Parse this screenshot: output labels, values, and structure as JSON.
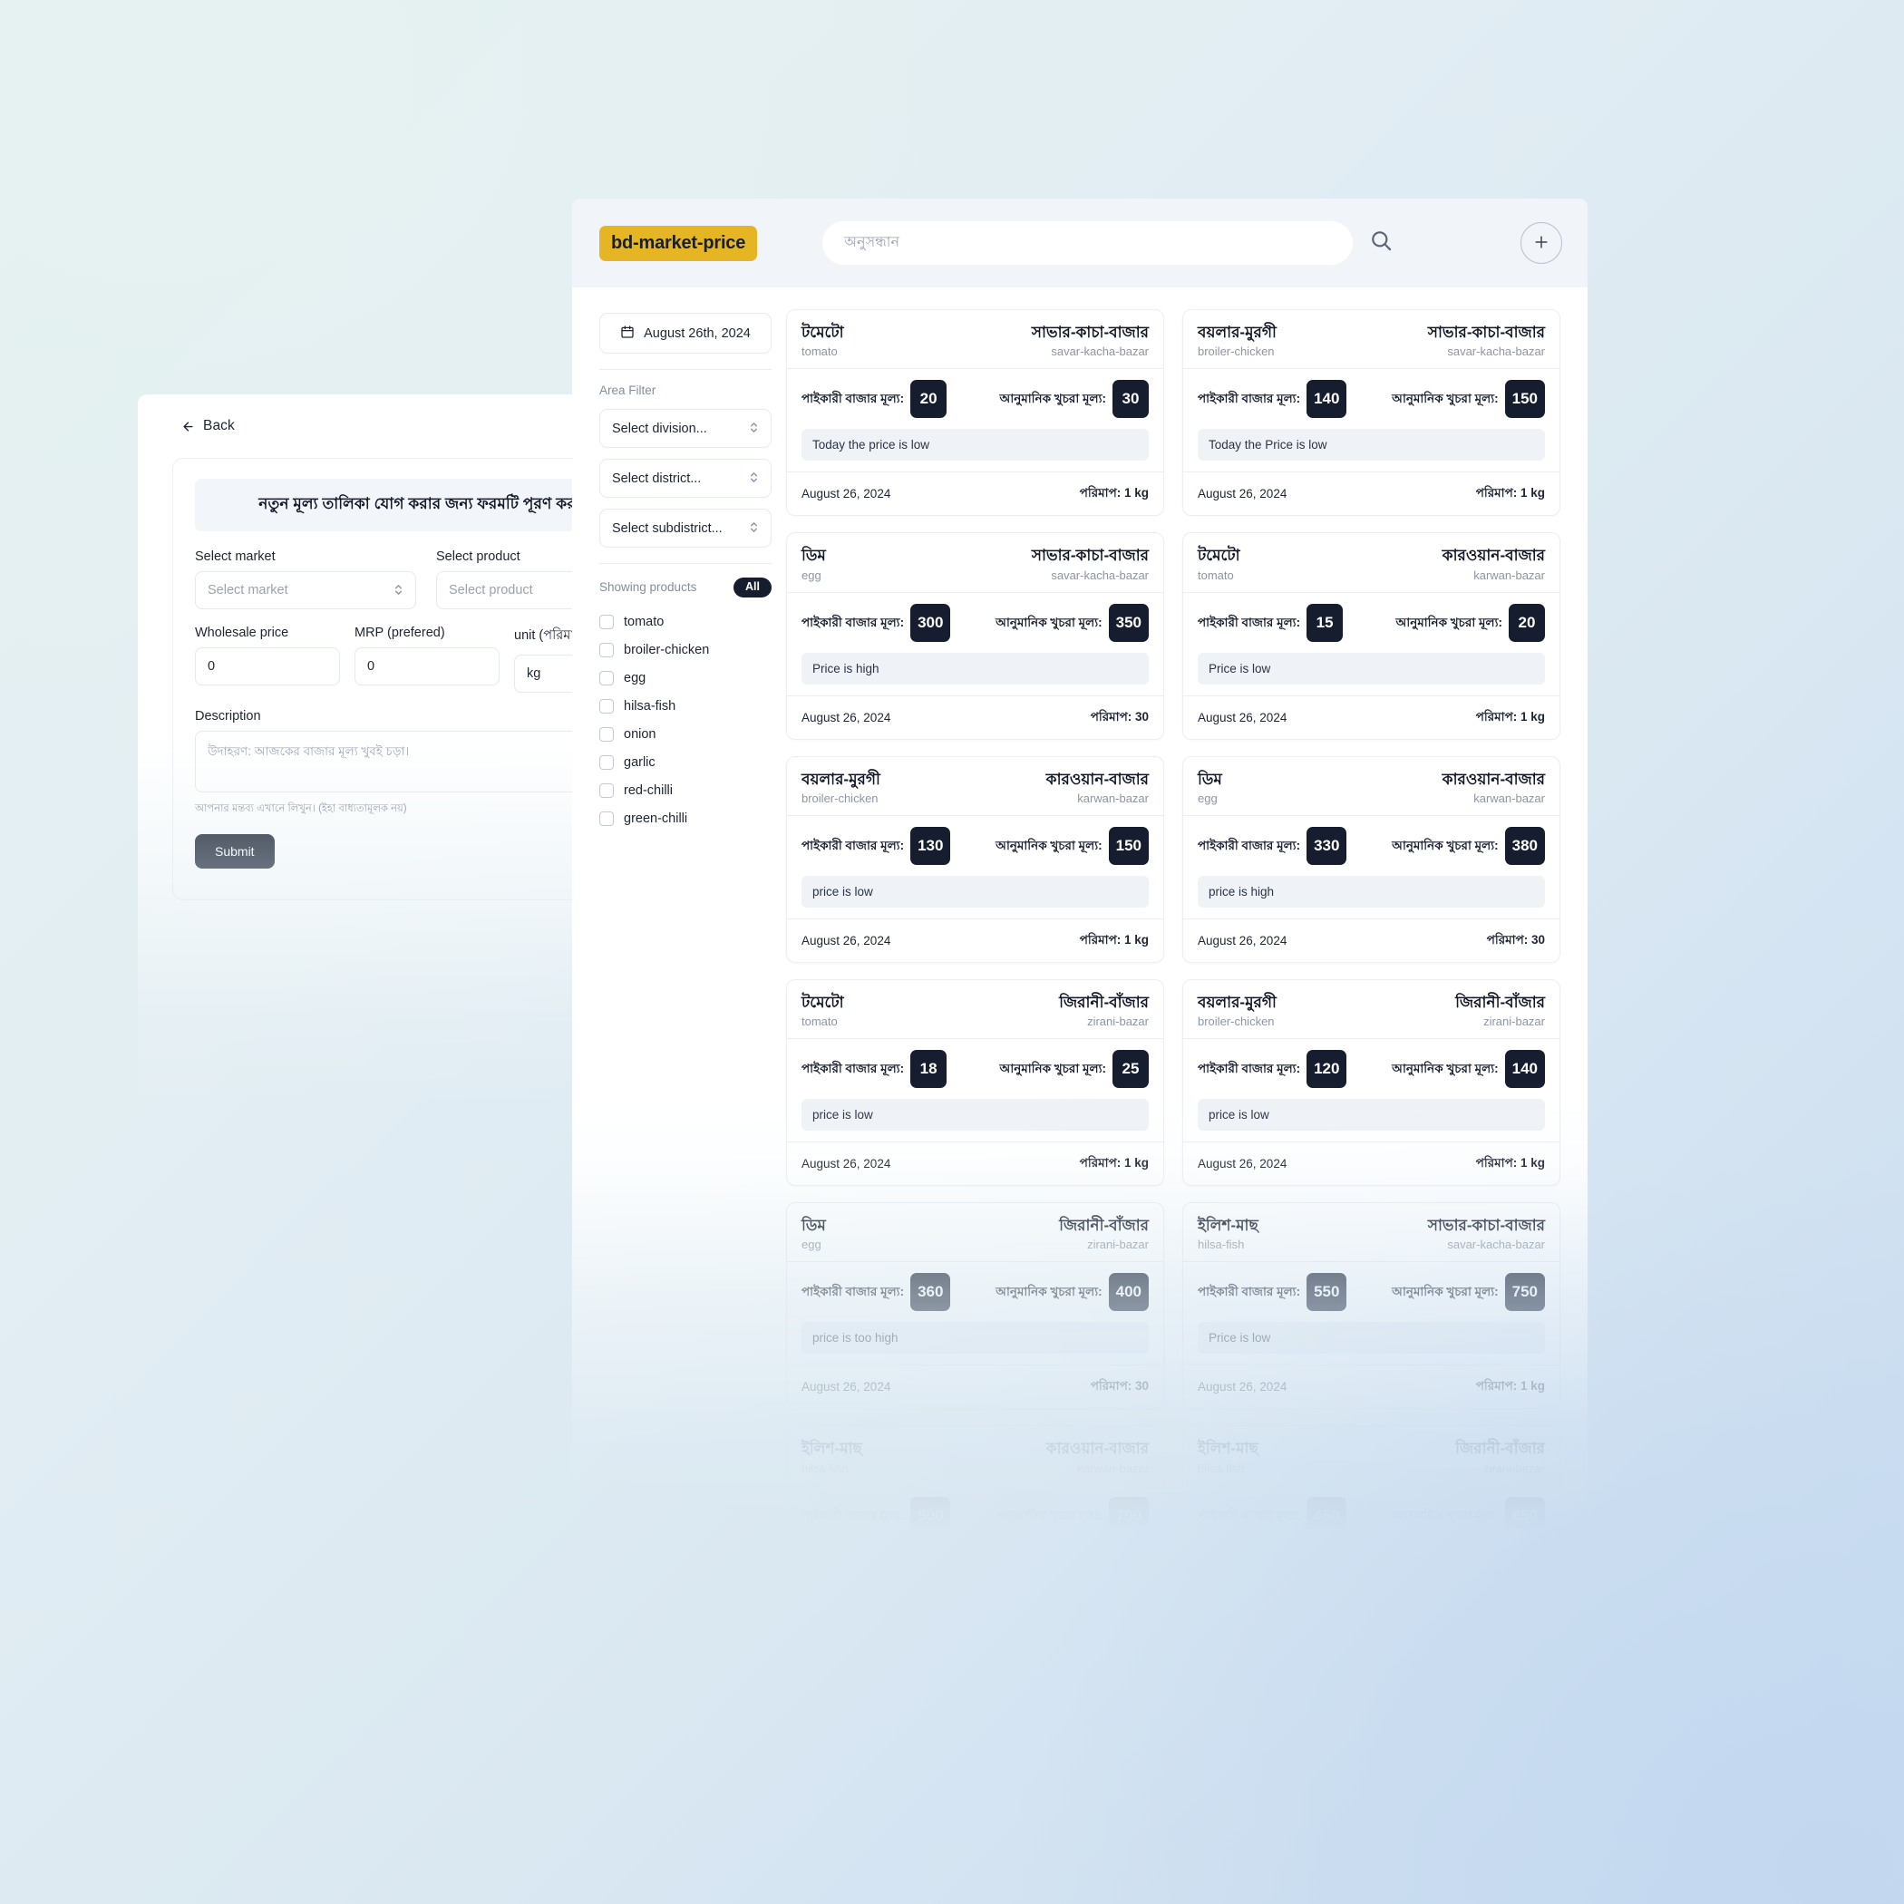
{
  "background_form": {
    "back_label": "Back",
    "title": "নতুন মূল্য তালিকা যোগ করার জন্য ফরমটি পূরণ করুন।",
    "fields": {
      "market_label": "Select market",
      "market_placeholder": "Select market",
      "product_label": "Select product",
      "product_placeholder": "Select product",
      "wholesale_label": "Wholesale price",
      "wholesale_value": "0",
      "mrp_label": "MRP (prefered)",
      "mrp_value": "0",
      "unit_label": "unit (পরিমাপ)",
      "unit_value": "kg",
      "description_label": "Description",
      "description_placeholder": "উদাহরণ: আজকের বাজার মূল্য খুবই চড়া।",
      "description_helper": "আপনার মন্তব্য এখানে লিখুন। (ইহা বাধ্যতামূলক নয়)"
    },
    "submit_label": "Submit"
  },
  "header": {
    "logo": "bd-market-price",
    "search_placeholder": "অনুসন্ধান",
    "search_value": "",
    "search_icon": "search-icon",
    "add_icon": "plus-icon"
  },
  "sidebar": {
    "date_icon": "calendar-icon",
    "date_label": "August 26th, 2024",
    "area_filter_label": "Area Filter",
    "selects": [
      {
        "label": "Select division...",
        "icon": "chevron-updown-icon"
      },
      {
        "label": "Select district...",
        "icon": "chevron-updown-icon"
      },
      {
        "label": "Select subdistrict...",
        "icon": "chevron-updown-icon"
      }
    ],
    "showing_label": "Showing products",
    "showing_badge": "All",
    "products": [
      {
        "label": "tomato",
        "checked": false
      },
      {
        "label": "broiler-chicken",
        "checked": false
      },
      {
        "label": "egg",
        "checked": false
      },
      {
        "label": "hilsa-fish",
        "checked": false
      },
      {
        "label": "onion",
        "checked": false
      },
      {
        "label": "garlic",
        "checked": false
      },
      {
        "label": "red-chilli",
        "checked": false
      },
      {
        "label": "green-chilli",
        "checked": false
      }
    ]
  },
  "card_labels": {
    "wholesale": "পাইকারী বাজার মূল্য:",
    "retail": "আনুমানিক খুচরা মূল্য:"
  },
  "colors": {
    "logo_bg": "#e5b523",
    "badge_bg": "#161d2e",
    "note_bg": "#eff2f7",
    "header_bg": "#f1f4f8"
  },
  "cards": [
    {
      "product_bn": "টমেটো",
      "product_en": "tomato",
      "market_bn": "সাভার-কাচা-বাজার",
      "market_en": "savar-kacha-bazar",
      "wholesale": "20",
      "retail": "30",
      "note": "Today the price is low",
      "date": "August 26, 2024",
      "measure": "পরিমাপ: 1 kg"
    },
    {
      "product_bn": "বয়লার-মুরগী",
      "product_en": "broiler-chicken",
      "market_bn": "সাভার-কাচা-বাজার",
      "market_en": "savar-kacha-bazar",
      "wholesale": "140",
      "retail": "150",
      "note": "Today the Price is low",
      "date": "August 26, 2024",
      "measure": "পরিমাপ: 1 kg"
    },
    {
      "product_bn": "ডিম",
      "product_en": "egg",
      "market_bn": "সাভার-কাচা-বাজার",
      "market_en": "savar-kacha-bazar",
      "wholesale": "300",
      "retail": "350",
      "note": "Price is high",
      "date": "August 26, 2024",
      "measure": "পরিমাপ: 30"
    },
    {
      "product_bn": "টমেটো",
      "product_en": "tomato",
      "market_bn": "কারওয়ান-বাজার",
      "market_en": "karwan-bazar",
      "wholesale": "15",
      "retail": "20",
      "note": "Price is low",
      "date": "August 26, 2024",
      "measure": "পরিমাপ: 1 kg"
    },
    {
      "product_bn": "বয়লার-মুরগী",
      "product_en": "broiler-chicken",
      "market_bn": "কারওয়ান-বাজার",
      "market_en": "karwan-bazar",
      "wholesale": "130",
      "retail": "150",
      "note": "price is low",
      "date": "August 26, 2024",
      "measure": "পরিমাপ: 1 kg"
    },
    {
      "product_bn": "ডিম",
      "product_en": "egg",
      "market_bn": "কারওয়ান-বাজার",
      "market_en": "karwan-bazar",
      "wholesale": "330",
      "retail": "380",
      "note": "price is high",
      "date": "August 26, 2024",
      "measure": "পরিমাপ: 30"
    },
    {
      "product_bn": "টমেটো",
      "product_en": "tomato",
      "market_bn": "জিরানী-বাঁজার",
      "market_en": "zirani-bazar",
      "wholesale": "18",
      "retail": "25",
      "note": "price is low",
      "date": "August 26, 2024",
      "measure": "পরিমাপ: 1 kg"
    },
    {
      "product_bn": "বয়লার-মুরগী",
      "product_en": "broiler-chicken",
      "market_bn": "জিরানী-বাঁজার",
      "market_en": "zirani-bazar",
      "wholesale": "120",
      "retail": "140",
      "note": "price is low",
      "date": "August 26, 2024",
      "measure": "পরিমাপ: 1 kg"
    },
    {
      "product_bn": "ডিম",
      "product_en": "egg",
      "market_bn": "জিরানী-বাঁজার",
      "market_en": "zirani-bazar",
      "wholesale": "360",
      "retail": "400",
      "note": "price is too high",
      "date": "August 26, 2024",
      "measure": "পরিমাপ: 30"
    },
    {
      "product_bn": "ইলিশ-মাছ",
      "product_en": "hilsa-fish",
      "market_bn": "সাভার-কাচা-বাজার",
      "market_en": "savar-kacha-bazar",
      "wholesale": "550",
      "retail": "750",
      "note": "Price is low",
      "date": "August 26, 2024",
      "measure": "পরিমাপ: 1 kg"
    },
    {
      "product_bn": "ইলিশ-মাছ",
      "product_en": "hilsa-fish",
      "market_bn": "কারওয়ান-বাজার",
      "market_en": "karwan-bazar",
      "wholesale": "500",
      "retail": "700",
      "note": "",
      "date": "",
      "measure": ""
    },
    {
      "product_bn": "ইলিশ-মাছ",
      "product_en": "hilsa-fish",
      "market_bn": "জিরানী-বাঁজার",
      "market_en": "zirani-bazar",
      "wholesale": "450",
      "retail": "650",
      "note": "",
      "date": "",
      "measure": ""
    }
  ]
}
